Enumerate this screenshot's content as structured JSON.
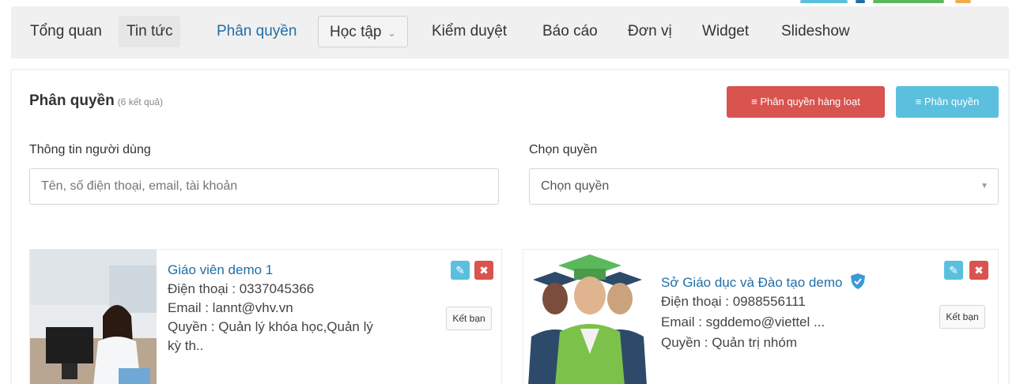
{
  "nav": {
    "items": [
      "Tổng quan",
      "Tin tức",
      "Phân quyền",
      "Học tập",
      "Kiểm duyệt",
      "Báo cáo",
      "Đơn vị",
      "Widget",
      "Slideshow"
    ]
  },
  "panel": {
    "title": "Phân quyền",
    "count": "(6 kết quả)",
    "bulk_button": "Phân quyền hàng loạt",
    "assign_button": "Phân quyền",
    "user_info_label": "Thông tin người dùng",
    "user_info_placeholder": "Tên, số điện thoại, email, tài khoản",
    "role_label": "Chọn quyền",
    "role_value": "Chọn quyền"
  },
  "cards": [
    {
      "name": "Giáo viên demo 1",
      "phone": "Điện thoại : 0337045366",
      "email": "Email : lannt@vhv.vn",
      "role_line1": "Quyền : Quản lý khóa học,Quản lý",
      "role_line2": "kỳ th..",
      "friend": "Kết bạn"
    },
    {
      "name": "Sở Giáo dục và Đào tạo demo",
      "phone": "Điện thoại : 0988556111",
      "email": "Email : sgddemo@viettel ...",
      "role_line1": "Quyền : Quản trị nhóm",
      "friend": "Kết bạn"
    }
  ],
  "colors": {
    "accent": "#1f6ea8",
    "danger": "#d9534f",
    "info": "#5bc0de",
    "nav_bg": "#f0f0f0"
  },
  "icons": [
    "edit-icon",
    "delete-icon",
    "verified-badge-icon",
    "sliders-icon",
    "chevron-down-icon",
    "caret-down-icon"
  ]
}
